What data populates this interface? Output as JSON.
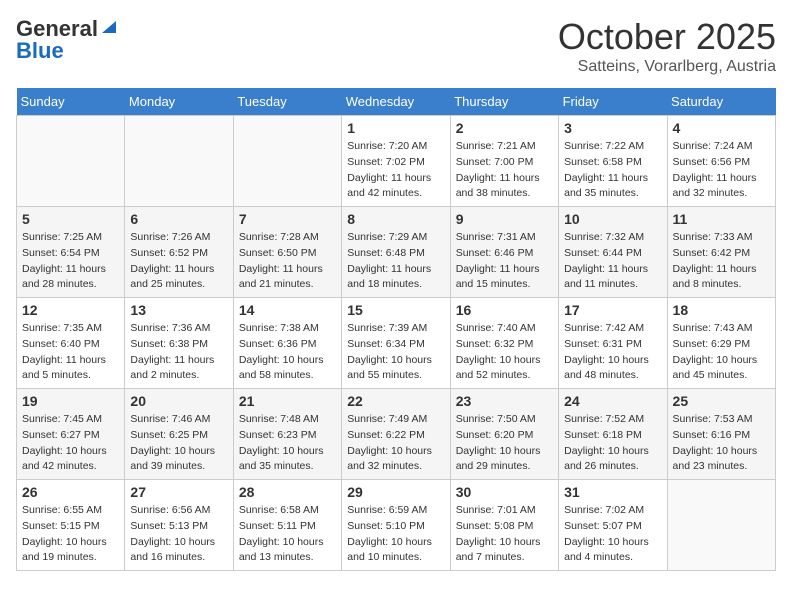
{
  "header": {
    "logo_general": "General",
    "logo_blue": "Blue",
    "title": "October 2025",
    "subtitle": "Satteins, Vorarlberg, Austria"
  },
  "days_of_week": [
    "Sunday",
    "Monday",
    "Tuesday",
    "Wednesday",
    "Thursday",
    "Friday",
    "Saturday"
  ],
  "weeks": [
    [
      {
        "day": "",
        "sunrise": "",
        "sunset": "",
        "daylight": ""
      },
      {
        "day": "",
        "sunrise": "",
        "sunset": "",
        "daylight": ""
      },
      {
        "day": "",
        "sunrise": "",
        "sunset": "",
        "daylight": ""
      },
      {
        "day": "1",
        "sunrise": "Sunrise: 7:20 AM",
        "sunset": "Sunset: 7:02 PM",
        "daylight": "Daylight: 11 hours and 42 minutes."
      },
      {
        "day": "2",
        "sunrise": "Sunrise: 7:21 AM",
        "sunset": "Sunset: 7:00 PM",
        "daylight": "Daylight: 11 hours and 38 minutes."
      },
      {
        "day": "3",
        "sunrise": "Sunrise: 7:22 AM",
        "sunset": "Sunset: 6:58 PM",
        "daylight": "Daylight: 11 hours and 35 minutes."
      },
      {
        "day": "4",
        "sunrise": "Sunrise: 7:24 AM",
        "sunset": "Sunset: 6:56 PM",
        "daylight": "Daylight: 11 hours and 32 minutes."
      }
    ],
    [
      {
        "day": "5",
        "sunrise": "Sunrise: 7:25 AM",
        "sunset": "Sunset: 6:54 PM",
        "daylight": "Daylight: 11 hours and 28 minutes."
      },
      {
        "day": "6",
        "sunrise": "Sunrise: 7:26 AM",
        "sunset": "Sunset: 6:52 PM",
        "daylight": "Daylight: 11 hours and 25 minutes."
      },
      {
        "day": "7",
        "sunrise": "Sunrise: 7:28 AM",
        "sunset": "Sunset: 6:50 PM",
        "daylight": "Daylight: 11 hours and 21 minutes."
      },
      {
        "day": "8",
        "sunrise": "Sunrise: 7:29 AM",
        "sunset": "Sunset: 6:48 PM",
        "daylight": "Daylight: 11 hours and 18 minutes."
      },
      {
        "day": "9",
        "sunrise": "Sunrise: 7:31 AM",
        "sunset": "Sunset: 6:46 PM",
        "daylight": "Daylight: 11 hours and 15 minutes."
      },
      {
        "day": "10",
        "sunrise": "Sunrise: 7:32 AM",
        "sunset": "Sunset: 6:44 PM",
        "daylight": "Daylight: 11 hours and 11 minutes."
      },
      {
        "day": "11",
        "sunrise": "Sunrise: 7:33 AM",
        "sunset": "Sunset: 6:42 PM",
        "daylight": "Daylight: 11 hours and 8 minutes."
      }
    ],
    [
      {
        "day": "12",
        "sunrise": "Sunrise: 7:35 AM",
        "sunset": "Sunset: 6:40 PM",
        "daylight": "Daylight: 11 hours and 5 minutes."
      },
      {
        "day": "13",
        "sunrise": "Sunrise: 7:36 AM",
        "sunset": "Sunset: 6:38 PM",
        "daylight": "Daylight: 11 hours and 2 minutes."
      },
      {
        "day": "14",
        "sunrise": "Sunrise: 7:38 AM",
        "sunset": "Sunset: 6:36 PM",
        "daylight": "Daylight: 10 hours and 58 minutes."
      },
      {
        "day": "15",
        "sunrise": "Sunrise: 7:39 AM",
        "sunset": "Sunset: 6:34 PM",
        "daylight": "Daylight: 10 hours and 55 minutes."
      },
      {
        "day": "16",
        "sunrise": "Sunrise: 7:40 AM",
        "sunset": "Sunset: 6:32 PM",
        "daylight": "Daylight: 10 hours and 52 minutes."
      },
      {
        "day": "17",
        "sunrise": "Sunrise: 7:42 AM",
        "sunset": "Sunset: 6:31 PM",
        "daylight": "Daylight: 10 hours and 48 minutes."
      },
      {
        "day": "18",
        "sunrise": "Sunrise: 7:43 AM",
        "sunset": "Sunset: 6:29 PM",
        "daylight": "Daylight: 10 hours and 45 minutes."
      }
    ],
    [
      {
        "day": "19",
        "sunrise": "Sunrise: 7:45 AM",
        "sunset": "Sunset: 6:27 PM",
        "daylight": "Daylight: 10 hours and 42 minutes."
      },
      {
        "day": "20",
        "sunrise": "Sunrise: 7:46 AM",
        "sunset": "Sunset: 6:25 PM",
        "daylight": "Daylight: 10 hours and 39 minutes."
      },
      {
        "day": "21",
        "sunrise": "Sunrise: 7:48 AM",
        "sunset": "Sunset: 6:23 PM",
        "daylight": "Daylight: 10 hours and 35 minutes."
      },
      {
        "day": "22",
        "sunrise": "Sunrise: 7:49 AM",
        "sunset": "Sunset: 6:22 PM",
        "daylight": "Daylight: 10 hours and 32 minutes."
      },
      {
        "day": "23",
        "sunrise": "Sunrise: 7:50 AM",
        "sunset": "Sunset: 6:20 PM",
        "daylight": "Daylight: 10 hours and 29 minutes."
      },
      {
        "day": "24",
        "sunrise": "Sunrise: 7:52 AM",
        "sunset": "Sunset: 6:18 PM",
        "daylight": "Daylight: 10 hours and 26 minutes."
      },
      {
        "day": "25",
        "sunrise": "Sunrise: 7:53 AM",
        "sunset": "Sunset: 6:16 PM",
        "daylight": "Daylight: 10 hours and 23 minutes."
      }
    ],
    [
      {
        "day": "26",
        "sunrise": "Sunrise: 6:55 AM",
        "sunset": "Sunset: 5:15 PM",
        "daylight": "Daylight: 10 hours and 19 minutes."
      },
      {
        "day": "27",
        "sunrise": "Sunrise: 6:56 AM",
        "sunset": "Sunset: 5:13 PM",
        "daylight": "Daylight: 10 hours and 16 minutes."
      },
      {
        "day": "28",
        "sunrise": "Sunrise: 6:58 AM",
        "sunset": "Sunset: 5:11 PM",
        "daylight": "Daylight: 10 hours and 13 minutes."
      },
      {
        "day": "29",
        "sunrise": "Sunrise: 6:59 AM",
        "sunset": "Sunset: 5:10 PM",
        "daylight": "Daylight: 10 hours and 10 minutes."
      },
      {
        "day": "30",
        "sunrise": "Sunrise: 7:01 AM",
        "sunset": "Sunset: 5:08 PM",
        "daylight": "Daylight: 10 hours and 7 minutes."
      },
      {
        "day": "31",
        "sunrise": "Sunrise: 7:02 AM",
        "sunset": "Sunset: 5:07 PM",
        "daylight": "Daylight: 10 hours and 4 minutes."
      },
      {
        "day": "",
        "sunrise": "",
        "sunset": "",
        "daylight": ""
      }
    ]
  ]
}
